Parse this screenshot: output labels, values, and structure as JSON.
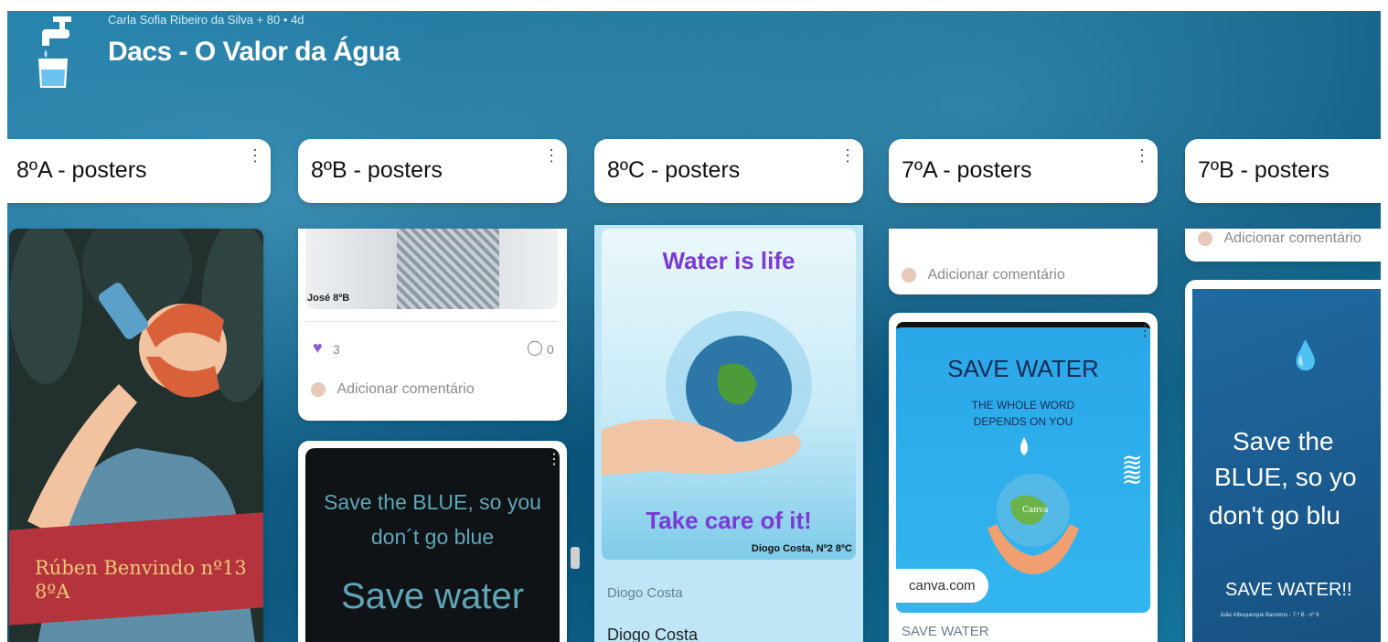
{
  "header": {
    "author": "Carla Sofia Ribeiro da Silva",
    "contributors": "+ 80",
    "age": "4d",
    "title": "Dacs - O Valor da Água"
  },
  "columns": [
    {
      "label": "8ºA - posters"
    },
    {
      "label": "8ºB - posters"
    },
    {
      "label": "8ºC - posters"
    },
    {
      "label": "7ºA - posters"
    },
    {
      "label": "7ºB - posters"
    }
  ],
  "col1": {
    "poster_caption": "Rúben Benvindo nº13\n8ºA"
  },
  "col2": {
    "card1": {
      "image_label": "José 8ºB",
      "likes": "3",
      "comments": "0",
      "add_comment": "Adicionar comentário"
    },
    "card2": {
      "line1": "Save the BLUE, so you",
      "line2": "don´t go blue",
      "line3": "Save water"
    }
  },
  "col3": {
    "poster_top": "Water is life",
    "poster_bottom": "Take care of it!",
    "poster_signature": "Diogo Costa, Nº2 8ºC",
    "author_line": "Diogo Costa",
    "title_line": "Diogo Costa"
  },
  "col4": {
    "card1": {
      "add_comment": "Adicionar comentário"
    },
    "card2": {
      "heading": "SAVE WATER",
      "sub1": "THE WHOLE WORD",
      "sub2": "DEPENDS ON YOU",
      "globe_label": "Canva",
      "link": "canva.com",
      "caption": "SAVE WATER"
    }
  },
  "col5": {
    "card1": {
      "add_comment": "Adicionar comentário"
    },
    "card2": {
      "line1": "Save the",
      "line2": "BLUE, so yo",
      "line3": "don't go blu",
      "line4": "SAVE WATER!!",
      "small": "João Albuquerque Barreiros - 7.º B - nº 9"
    }
  },
  "icons": {
    "logo": "water-tap-glass-icon",
    "menu": "more-vert-icon",
    "heart": "heart-icon",
    "comment": "comment-icon"
  },
  "colors": {
    "ocean": "#15648c",
    "accent_purple": "#8a5cd6",
    "banner_red": "#b5333c"
  }
}
